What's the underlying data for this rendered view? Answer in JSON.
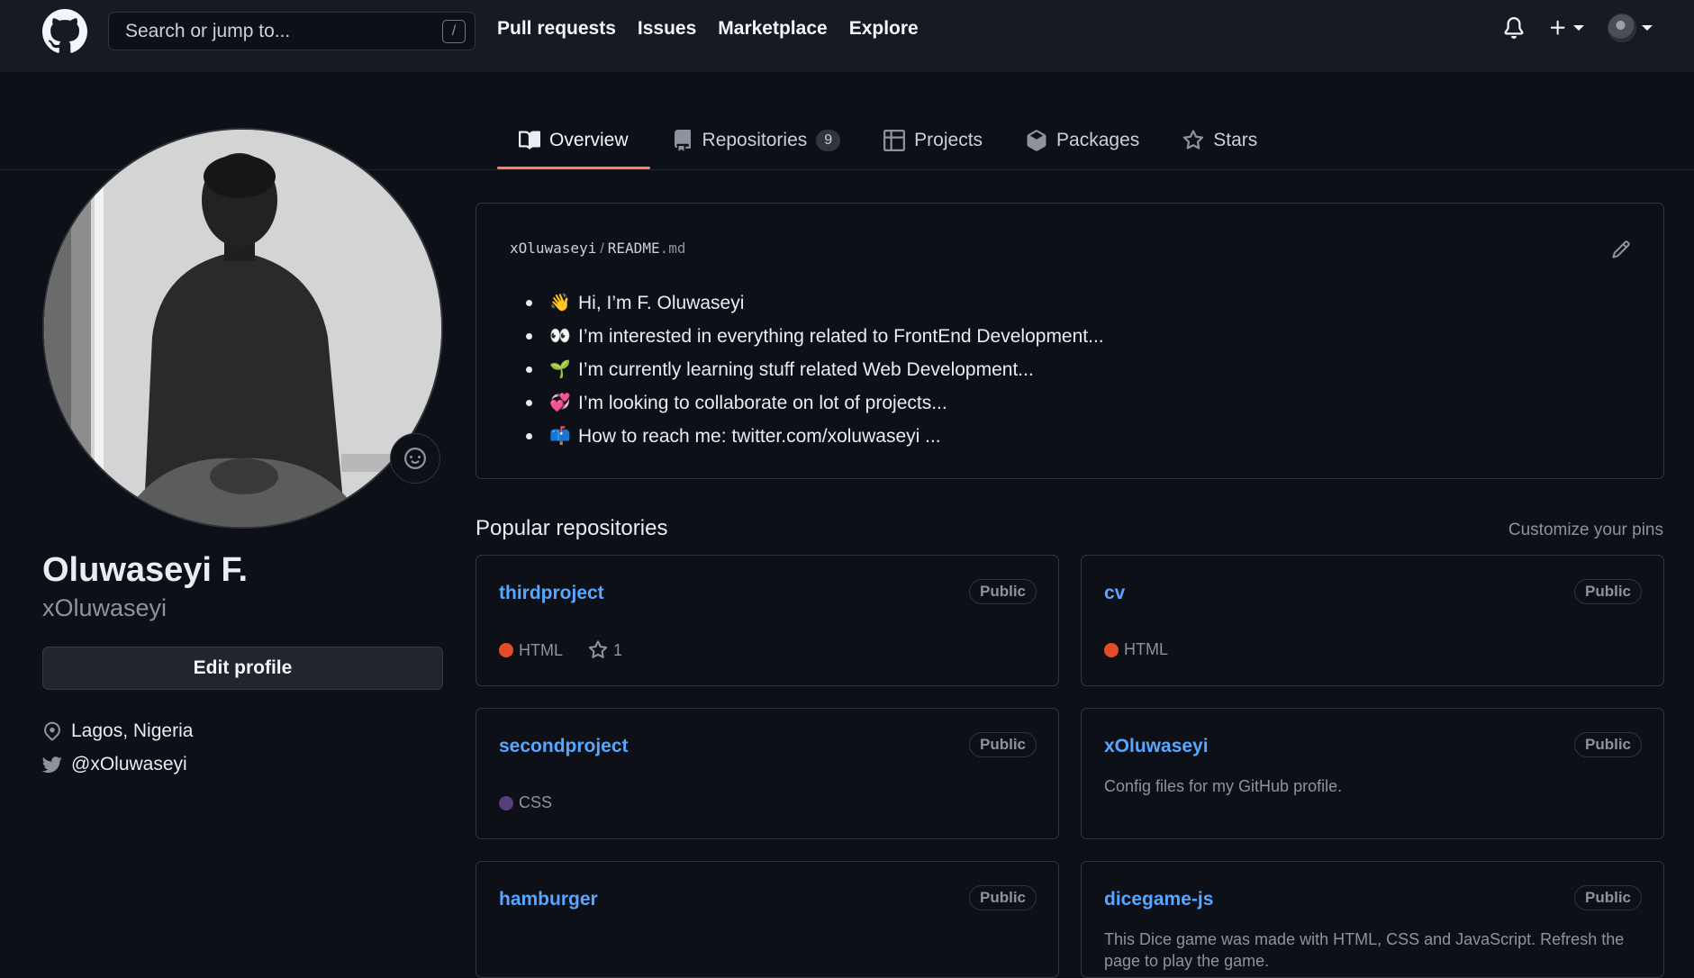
{
  "header": {
    "search_placeholder": "Search or jump to...",
    "slash_key": "/",
    "nav": [
      "Pull requests",
      "Issues",
      "Marketplace",
      "Explore"
    ]
  },
  "tabs": [
    {
      "label": "Overview",
      "icon": "book-icon",
      "active": true
    },
    {
      "label": "Repositories",
      "icon": "repo-icon",
      "count": "9"
    },
    {
      "label": "Projects",
      "icon": "table-icon"
    },
    {
      "label": "Packages",
      "icon": "package-icon"
    },
    {
      "label": "Stars",
      "icon": "star-icon"
    }
  ],
  "profile": {
    "name": "Oluwaseyi F.",
    "login": "xOluwaseyi",
    "edit_label": "Edit profile",
    "location": "Lagos, Nigeria",
    "twitter": "@xOluwaseyi"
  },
  "readme": {
    "owner": "xOluwaseyi",
    "sep": "/",
    "file": "README",
    "ext": ".md",
    "items": [
      {
        "emoji": "👋",
        "text": "Hi, I’m F. Oluwaseyi"
      },
      {
        "emoji": "👀",
        "text": "I’m interested in everything related to FrontEnd Development..."
      },
      {
        "emoji": "🌱",
        "text": "I’m currently learning stuff related Web Development..."
      },
      {
        "emoji": "💞",
        "text": "I’m looking to collaborate on lot of projects..."
      },
      {
        "emoji": "📫",
        "text": "How to reach me: twitter.com/xoluwaseyi ..."
      }
    ]
  },
  "popular": {
    "title": "Popular repositories",
    "customize": "Customize your pins",
    "repos": [
      {
        "name": "thirdproject",
        "badge": "Public",
        "language": "HTML",
        "lang_color": "#e34c26",
        "stars": "1"
      },
      {
        "name": "cv",
        "badge": "Public",
        "language": "HTML",
        "lang_color": "#e34c26"
      },
      {
        "name": "secondproject",
        "badge": "Public",
        "language": "CSS",
        "lang_color": "#563d7c"
      },
      {
        "name": "xOluwaseyi",
        "badge": "Public",
        "description": "Config files for my GitHub profile."
      },
      {
        "name": "hamburger",
        "badge": "Public"
      },
      {
        "name": "dicegame-js",
        "badge": "Public",
        "description": "This Dice game was made with HTML, CSS and JavaScript. Refresh the page to play the game."
      }
    ]
  },
  "colors": {
    "bg": "#0d1117",
    "header_bg": "#161b22",
    "link": "#58a6ff",
    "tab_underline": "#f78166",
    "border": "#30363d"
  }
}
